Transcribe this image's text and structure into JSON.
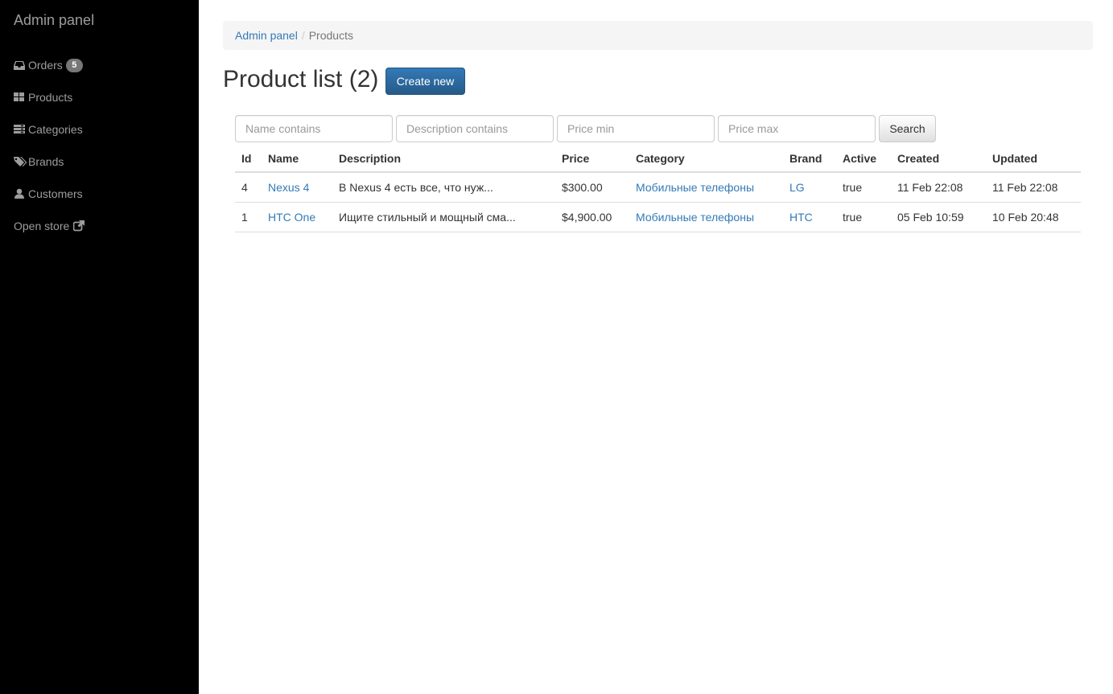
{
  "sidebar": {
    "brand": "Admin panel",
    "items": [
      {
        "label": "Orders",
        "icon": "inbox-icon",
        "badge": "5"
      },
      {
        "label": "Products",
        "icon": "grid-icon"
      },
      {
        "label": "Categories",
        "icon": "stack-icon"
      },
      {
        "label": "Brands",
        "icon": "tags-icon"
      },
      {
        "label": "Customers",
        "icon": "user-icon"
      },
      {
        "label": "Open store",
        "icon": "external-link-icon"
      }
    ]
  },
  "breadcrumb": {
    "root": "Admin panel",
    "separator": "/",
    "current": "Products"
  },
  "page": {
    "title": "Product list (2)",
    "create_button": "Create new"
  },
  "filters": {
    "name_placeholder": "Name contains",
    "description_placeholder": "Description contains",
    "price_min_placeholder": "Price min",
    "price_max_placeholder": "Price max",
    "search_button": "Search"
  },
  "table": {
    "headers": [
      "Id",
      "Name",
      "Description",
      "Price",
      "Category",
      "Brand",
      "Active",
      "Created",
      "Updated"
    ],
    "rows": [
      {
        "id": "4",
        "name": "Nexus 4",
        "description": "В Nexus 4 есть все, что нуж...",
        "price": "$300.00",
        "category": "Мобильные телефоны",
        "brand": "LG",
        "active": "true",
        "created": "11 Feb 22:08",
        "updated": "11 Feb 22:08"
      },
      {
        "id": "1",
        "name": "HTC One",
        "description": "Ищите стильный и мощный сма...",
        "price": "$4,900.00",
        "category": "Мобильные телефоны",
        "brand": "HTC",
        "active": "true",
        "created": "05 Feb 10:59",
        "updated": "10 Feb 20:48"
      }
    ]
  },
  "colors": {
    "sidebar_bg": "#000000",
    "sidebar_text": "#9d9d9d",
    "link": "#337ab7",
    "primary_button": "#337ab7",
    "badge": "#777777"
  }
}
